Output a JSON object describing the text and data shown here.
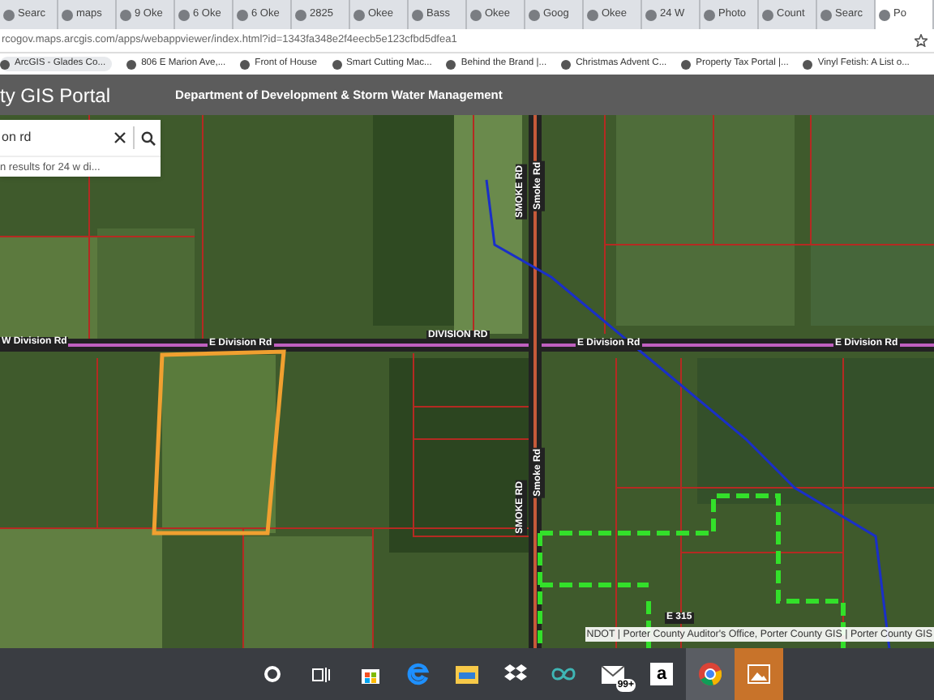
{
  "browser": {
    "tabs": [
      {
        "label": "Searc",
        "selected": false
      },
      {
        "label": "maps",
        "selected": false
      },
      {
        "label": "9 Oke",
        "selected": false
      },
      {
        "label": "6 Oke",
        "selected": false
      },
      {
        "label": "6 Oke",
        "selected": false
      },
      {
        "label": "2825",
        "selected": false
      },
      {
        "label": "Okee",
        "selected": false
      },
      {
        "label": "Bass",
        "selected": false
      },
      {
        "label": "Okee",
        "selected": false
      },
      {
        "label": "Goog",
        "selected": false
      },
      {
        "label": "Okee",
        "selected": false
      },
      {
        "label": "24 W",
        "selected": false
      },
      {
        "label": "Photo",
        "selected": false
      },
      {
        "label": "Count",
        "selected": false
      },
      {
        "label": "Searc",
        "selected": false
      },
      {
        "label": "Po",
        "selected": true
      }
    ],
    "address": "rcogov.maps.arcgis.com/apps/webappviewer/index.html?id=1343fa348e2f4eecb5e123cfbd5dfea1",
    "bookmarks": [
      "ArcGIS - Glades Co...",
      "806 E Marion Ave,...",
      "Front of House",
      "Smart Cutting Mac...",
      "Behind the Brand |...",
      "Christmas Advent C...",
      "Property Tax Portal |...",
      "Vinyl Fetish: A List o..."
    ]
  },
  "app": {
    "title": "ty GIS Portal",
    "subtitle": "Department of Development & Storm Water Management"
  },
  "search": {
    "value": "on rd",
    "suggestion": "n results for 24 w di..."
  },
  "map": {
    "road_labels": [
      {
        "text": "W Division Rd",
        "kind": "horizontal"
      },
      {
        "text": "E Division Rd",
        "kind": "horizontal"
      },
      {
        "text": "DIVISION RD",
        "kind": "horizontal"
      },
      {
        "text": "E Division Rd",
        "kind": "horizontal"
      },
      {
        "text": "E Division Rd",
        "kind": "horizontal"
      },
      {
        "text": "SMOKE RD",
        "kind": "vertical"
      },
      {
        "text": "Smoke Rd",
        "kind": "vertical"
      },
      {
        "text": "SMOKE RD",
        "kind": "vertical"
      },
      {
        "text": "Smoke Rd",
        "kind": "vertical"
      },
      {
        "text": "E 315",
        "kind": "horizontal"
      }
    ],
    "attribution": "NDOT | Porter County Auditor's Office, Porter County GIS | Porter County GIS"
  },
  "taskbar": [
    {
      "kind": "cortana",
      "selected": false
    },
    {
      "kind": "taskview",
      "selected": false
    },
    {
      "kind": "store",
      "selected": false
    },
    {
      "kind": "edge",
      "selected": false
    },
    {
      "kind": "explorer",
      "selected": false
    },
    {
      "kind": "dropbox",
      "selected": false
    },
    {
      "kind": "arduino",
      "selected": false
    },
    {
      "kind": "mail",
      "badge": "99+",
      "selected": false
    },
    {
      "kind": "amazon",
      "label": "a",
      "selected": false
    },
    {
      "kind": "chrome",
      "selected": true
    },
    {
      "kind": "photos",
      "selected": true
    }
  ]
}
